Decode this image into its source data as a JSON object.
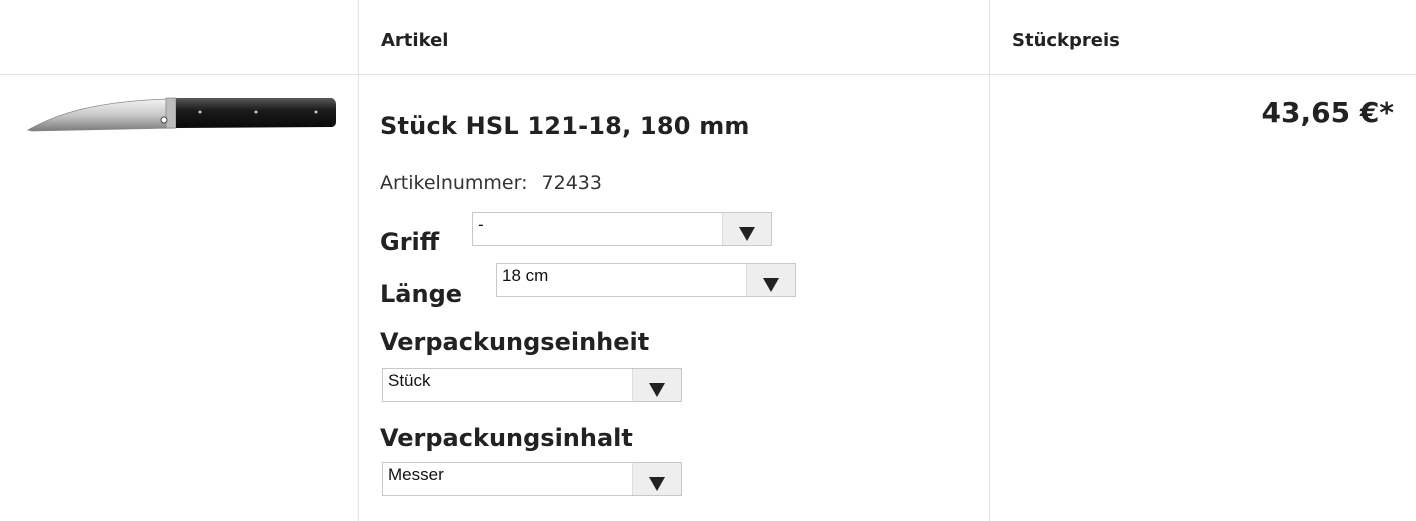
{
  "header": {
    "col_article": "Artikel",
    "col_unit_price": "Stückpreis"
  },
  "product": {
    "image_icon": "knife-image",
    "title": "Stück HSL 121-18, 180 mm",
    "article_number_label": "Artikelnummer:",
    "article_number": "72433",
    "price": "43,65 €*"
  },
  "options": {
    "griff": {
      "label": "Griff",
      "value": "-"
    },
    "laenge": {
      "label": "Länge",
      "value": "18 cm"
    },
    "verpackungseinheit": {
      "label": "Verpackungseinheit",
      "value": "Stück"
    },
    "verpackungsinhalt": {
      "label": "Verpackungsinhalt",
      "value": "Messer"
    }
  },
  "colors": {
    "text": "#222222",
    "border": "#e3e3e3",
    "select_arrow_bg": "#eeeeee"
  }
}
